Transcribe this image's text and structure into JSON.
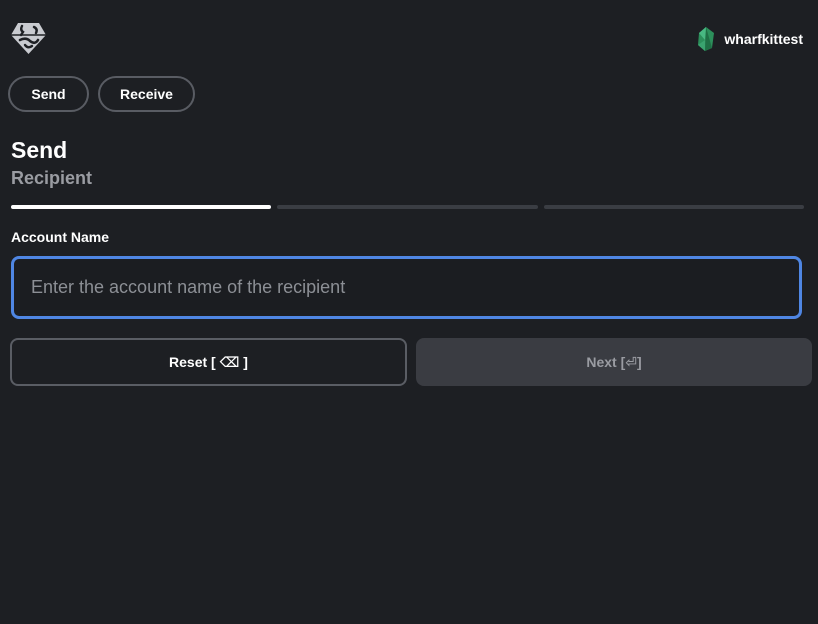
{
  "header": {
    "logo_icon": "wharf-logo-icon",
    "account_name": "wharfkittest",
    "avatar_icon": "wax-avatar-icon"
  },
  "nav": {
    "send_label": "Send",
    "receive_label": "Receive"
  },
  "form": {
    "title": "Send",
    "step_title": "Recipient",
    "progress": {
      "current_step": 1,
      "total_steps": 3
    },
    "field_label": "Account Name",
    "input_placeholder": "Enter the account name of the recipient",
    "input_value": "",
    "reset_label": "Reset [ ⌫ ]",
    "next_label": "Next [⏎]"
  },
  "colors": {
    "background": "#1d1f23",
    "focus_ring": "#4f86e3",
    "progress_active": "#ffffff",
    "progress_inactive": "#3a3d43"
  }
}
